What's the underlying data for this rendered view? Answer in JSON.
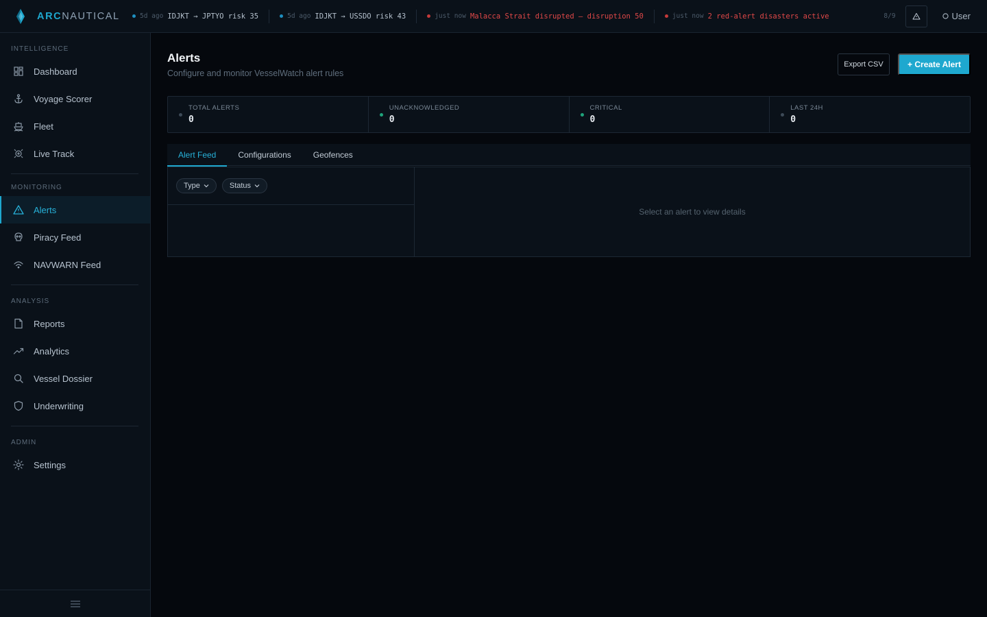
{
  "brand": {
    "accent": "ARC",
    "rest": "NAUTICAL"
  },
  "ticker": [
    {
      "ago": "5d ago",
      "text": "IDJKT → JPTYO risk 35",
      "dot": "#1e8fc0",
      "tone": "normal"
    },
    {
      "ago": "5d ago",
      "text": "IDJKT → USSDO risk 43",
      "dot": "#1e8fc0",
      "tone": "normal"
    },
    {
      "ago": "just now",
      "text": "Malacca Strait disrupted — disruption 50",
      "dot": "#c43a3a",
      "tone": "red"
    },
    {
      "ago": "just now",
      "text": "2 red-alert disasters active",
      "dot": "#c43a3a",
      "tone": "red"
    }
  ],
  "topbar": {
    "pager": "8/9",
    "user_label": "User"
  },
  "sidebar": {
    "sections": [
      {
        "label": "INTELLIGENCE",
        "items": [
          "Dashboard",
          "Voyage Scorer",
          "Fleet",
          "Live Track"
        ]
      },
      {
        "label": "MONITORING",
        "items": [
          "Alerts",
          "Piracy Feed",
          "NAVWARN Feed"
        ]
      },
      {
        "label": "ANALYSIS",
        "items": [
          "Reports",
          "Analytics",
          "Vessel Dossier",
          "Underwriting"
        ]
      },
      {
        "label": "ADMIN",
        "items": [
          "Settings"
        ]
      }
    ],
    "active": "Alerts"
  },
  "page": {
    "title": "Alerts",
    "subtitle": "Configure and monitor VesselWatch alert rules",
    "export_label": "Export CSV",
    "create_label": "+ Create Alert"
  },
  "stats": [
    {
      "label": "TOTAL ALERTS",
      "value": "0",
      "dot": "#3d4a57"
    },
    {
      "label": "UNACKNOWLEDGED",
      "value": "0",
      "dot": "#1fa37a"
    },
    {
      "label": "CRITICAL",
      "value": "0",
      "dot": "#1fa37a"
    },
    {
      "label": "LAST 24H",
      "value": "0",
      "dot": "#3d4a57"
    }
  ],
  "tabs": [
    {
      "label": "Alert Feed",
      "active": true
    },
    {
      "label": "Configurations",
      "active": false
    },
    {
      "label": "Geofences",
      "active": false
    }
  ],
  "filters": {
    "type_label": "Type",
    "status_label": "Status"
  },
  "detail": {
    "empty_text": "Select an alert to view details"
  },
  "colors": {
    "accent": "#1ea8cf",
    "background": "#05080d",
    "panel": "#0a1119",
    "danger": "#e04848"
  }
}
